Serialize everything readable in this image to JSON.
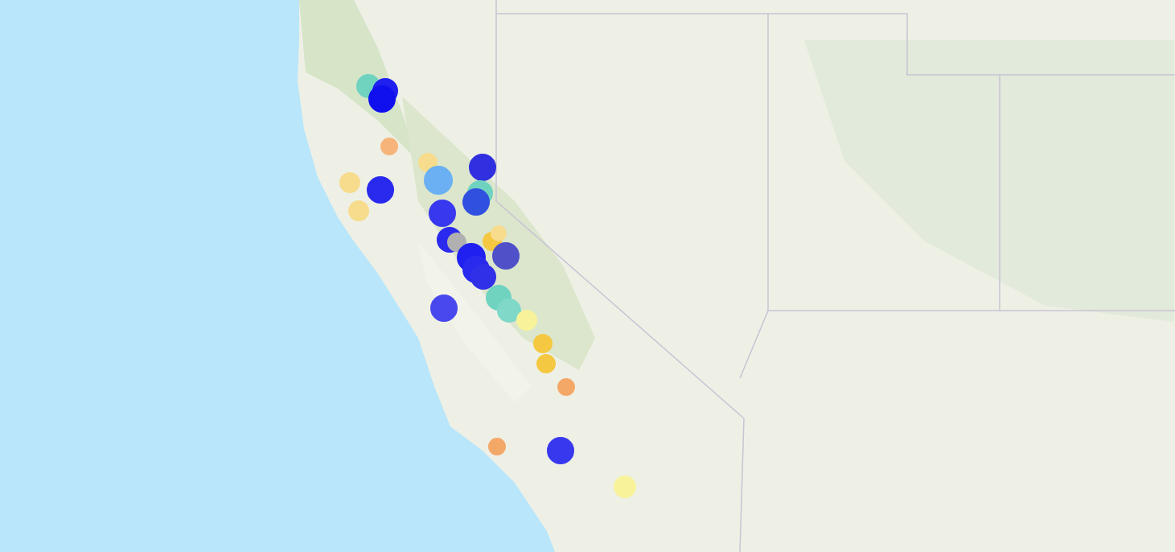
{
  "map": {
    "markers": [
      {
        "color": "#6fd3c0"
      },
      {
        "color": "#2020f0"
      },
      {
        "color": "#1010ee"
      },
      {
        "color": "#f7b47a"
      },
      {
        "color": "#f6dc8c"
      },
      {
        "color": "#3030e0"
      },
      {
        "color": "#6ab0f2"
      },
      {
        "color": "#f6dc8c"
      },
      {
        "color": "#2a2aee"
      },
      {
        "color": "#6fd3c0"
      },
      {
        "color": "#3050e0"
      },
      {
        "color": "#f6dc8c"
      },
      {
        "color": "#3838ee"
      },
      {
        "color": "#2a2aee"
      },
      {
        "color": "#b0b0b0"
      },
      {
        "color": "#f5c842"
      },
      {
        "color": "#f6dc8c"
      },
      {
        "color": "#5050c8"
      },
      {
        "color": "#2020f0"
      },
      {
        "color": "#2a2aee"
      },
      {
        "color": "#3030e8"
      },
      {
        "color": "#6fd3c0"
      },
      {
        "color": "#7fd8c8"
      },
      {
        "color": "#f8f39a"
      },
      {
        "color": "#4848ee"
      },
      {
        "color": "#f5c842"
      },
      {
        "color": "#f5c842"
      },
      {
        "color": "#f4a868"
      },
      {
        "color": "#f4a868"
      },
      {
        "color": "#3838ee"
      },
      {
        "color": "#f8f39a"
      }
    ]
  }
}
